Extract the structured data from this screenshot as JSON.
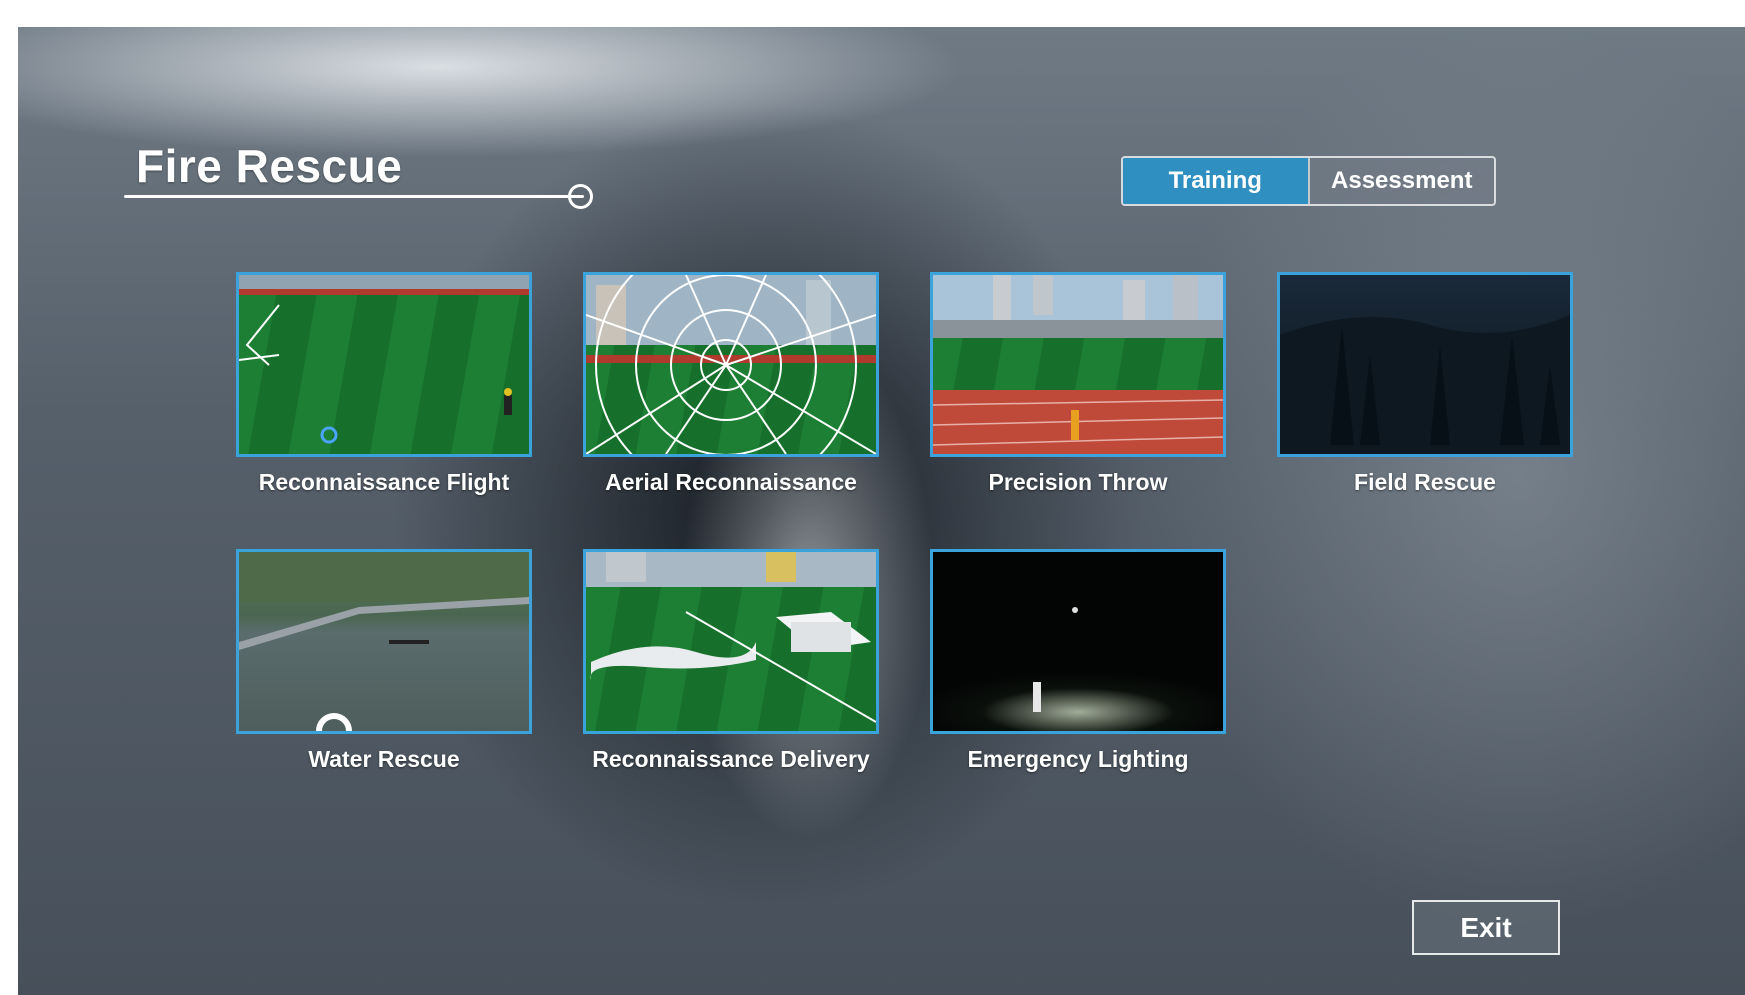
{
  "header": {
    "title": "Fire Rescue"
  },
  "tabs": [
    {
      "label": "Training",
      "active": true
    },
    {
      "label": "Assessment",
      "active": false
    }
  ],
  "scenarios": [
    {
      "label": "Reconnaissance Flight"
    },
    {
      "label": "Aerial Reconnaissance"
    },
    {
      "label": "Precision Throw"
    },
    {
      "label": "Field Rescue"
    },
    {
      "label": "Water Rescue"
    },
    {
      "label": "Reconnaissance Delivery"
    },
    {
      "label": "Emergency Lighting"
    }
  ],
  "footer": {
    "exit_label": "Exit"
  },
  "colors": {
    "accent": "#2e8fc0",
    "card_border": "#3aa3dc"
  }
}
